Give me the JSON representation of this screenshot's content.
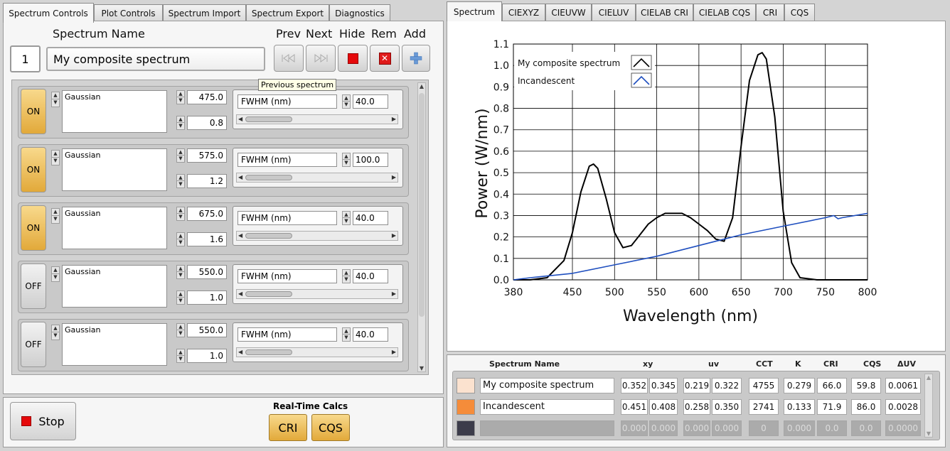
{
  "left_tabs": [
    "Spectrum Controls",
    "Plot Controls",
    "Spectrum Import",
    "Spectrum Export",
    "Diagnostics"
  ],
  "right_tabs": [
    "Spectrum",
    "CIEXYZ",
    "CIEUVW",
    "CIELUV",
    "CIELAB CRI",
    "CIELAB CQS",
    "CRI",
    "CQS"
  ],
  "controls": {
    "headers": {
      "name": "Spectrum Name",
      "prev": "Prev",
      "next": "Next",
      "hide": "Hide",
      "rem": "Rem",
      "add": "Add"
    },
    "index": "1",
    "spectrum_name": "My composite spectrum",
    "tooltip": "Previous spectrum"
  },
  "components": [
    {
      "state": "ON",
      "function": "Gaussian",
      "center": "475.0",
      "amplitude": "0.8",
      "param_name": "FWHM (nm)",
      "param_value": "40.0"
    },
    {
      "state": "ON",
      "function": "Gaussian",
      "center": "575.0",
      "amplitude": "1.2",
      "param_name": "FWHM (nm)",
      "param_value": "100.0"
    },
    {
      "state": "ON",
      "function": "Gaussian",
      "center": "675.0",
      "amplitude": "1.6",
      "param_name": "FWHM (nm)",
      "param_value": "40.0"
    },
    {
      "state": "OFF",
      "function": "Gaussian",
      "center": "550.0",
      "amplitude": "1.0",
      "param_name": "FWHM (nm)",
      "param_value": "40.0"
    },
    {
      "state": "OFF",
      "function": "Gaussian",
      "center": "550.0",
      "amplitude": "1.0",
      "param_name": "FWHM (nm)",
      "param_value": "40.0"
    }
  ],
  "bottom": {
    "stop": "Stop",
    "realtime_title": "Real-Time Calcs",
    "cri": "CRI",
    "cqs": "CQS"
  },
  "table": {
    "headers": {
      "name": "Spectrum Name",
      "xy": "xy",
      "uv": "uv",
      "cct": "CCT",
      "k": "K",
      "cri": "CRI",
      "cqs": "CQS",
      "duv": "ΔUV"
    },
    "rows": [
      {
        "color": "#fbe2cf",
        "name": "My composite spectrum",
        "x": "0.352",
        "y": "0.345",
        "u": "0.219",
        "v": "0.322",
        "cct": "4755",
        "k": "0.279",
        "cri": "66.0",
        "cqs": "59.8",
        "duv": "0.0061"
      },
      {
        "color": "#f58c3a",
        "name": "Incandescent",
        "x": "0.451",
        "y": "0.408",
        "u": "0.258",
        "v": "0.350",
        "cct": "2741",
        "k": "0.133",
        "cri": "71.9",
        "cqs": "86.0",
        "duv": "0.0028"
      },
      {
        "color": "#3c3c4a",
        "name": "",
        "x": "0.000",
        "y": "0.000",
        "u": "0.000",
        "v": "0.000",
        "cct": "0",
        "k": "0.000",
        "cri": "0.0",
        "cqs": "0.0",
        "duv": "0.0000"
      }
    ]
  },
  "chart_data": {
    "type": "line",
    "title": "",
    "xlabel": "Wavelength (nm)",
    "ylabel": "Power (W/nm)",
    "xlim": [
      380,
      800
    ],
    "ylim": [
      0,
      1.1
    ],
    "xticks": [
      "380",
      "450",
      "500",
      "550",
      "600",
      "650",
      "700",
      "750",
      "800"
    ],
    "yticks": [
      "0.0",
      "0.1",
      "0.2",
      "0.3",
      "0.4",
      "0.5",
      "0.6",
      "0.7",
      "0.8",
      "0.9",
      "1.0",
      "1.1"
    ],
    "grid": true,
    "legend_position": "top-left",
    "series": [
      {
        "name": "My composite spectrum",
        "color": "#000000",
        "x": [
          380,
          400,
          420,
          440,
          450,
          460,
          470,
          475,
          480,
          490,
          500,
          510,
          520,
          530,
          540,
          550,
          560,
          570,
          575,
          580,
          590,
          600,
          610,
          620,
          630,
          640,
          650,
          660,
          670,
          675,
          680,
          690,
          700,
          710,
          720,
          740,
          760,
          800
        ],
        "y": [
          0.0,
          0.0,
          0.01,
          0.09,
          0.22,
          0.41,
          0.53,
          0.54,
          0.52,
          0.38,
          0.22,
          0.15,
          0.16,
          0.21,
          0.26,
          0.29,
          0.31,
          0.31,
          0.31,
          0.31,
          0.29,
          0.26,
          0.23,
          0.19,
          0.18,
          0.29,
          0.62,
          0.93,
          1.05,
          1.06,
          1.03,
          0.76,
          0.32,
          0.08,
          0.01,
          0.0,
          0.0,
          0.0
        ]
      },
      {
        "name": "Incandescent",
        "color": "#1f4fbf",
        "x": [
          380,
          400,
          450,
          500,
          550,
          600,
          650,
          700,
          750,
          760,
          765,
          770,
          800
        ],
        "y": [
          0.0,
          0.01,
          0.03,
          0.07,
          0.11,
          0.16,
          0.21,
          0.25,
          0.29,
          0.3,
          0.285,
          0.29,
          0.31
        ]
      }
    ]
  }
}
